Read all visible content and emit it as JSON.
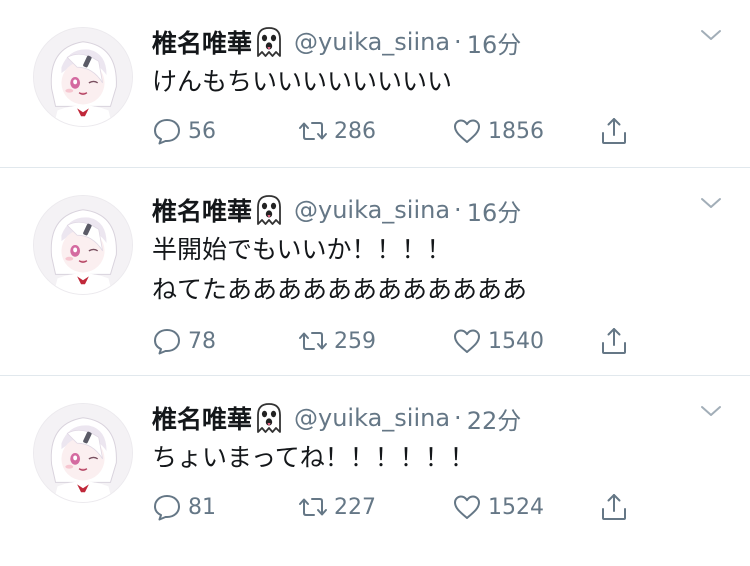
{
  "tweets": [
    {
      "name": "椎名唯華",
      "handle": "@yuika_siina",
      "separator": "·",
      "time": "16分",
      "lines": [
        "けんもちいいいいいいいい"
      ],
      "replies": "56",
      "retweets": "286",
      "likes": "1856"
    },
    {
      "name": "椎名唯華",
      "handle": "@yuika_siina",
      "separator": "·",
      "time": "16分",
      "lines": [
        "半開始でもいいか！！！！",
        "ねてたああああああああああああ"
      ],
      "replies": "78",
      "retweets": "259",
      "likes": "1540"
    },
    {
      "name": "椎名唯華",
      "handle": "@yuika_siina",
      "separator": "·",
      "time": "22分",
      "lines": [
        "ちょいまってね！！！！！！"
      ],
      "replies": "81",
      "retweets": "227",
      "likes": "1524"
    }
  ],
  "icons": {
    "name_emoji": "ghost-icon",
    "menu": "chevron-down-icon",
    "reply": "reply-icon",
    "retweet": "retweet-icon",
    "like": "heart-icon",
    "share": "share-icon"
  },
  "colors": {
    "text": "#14171a",
    "secondary": "#657786",
    "divider": "#e1e8ed",
    "avatar_accent": "#c0283a"
  }
}
